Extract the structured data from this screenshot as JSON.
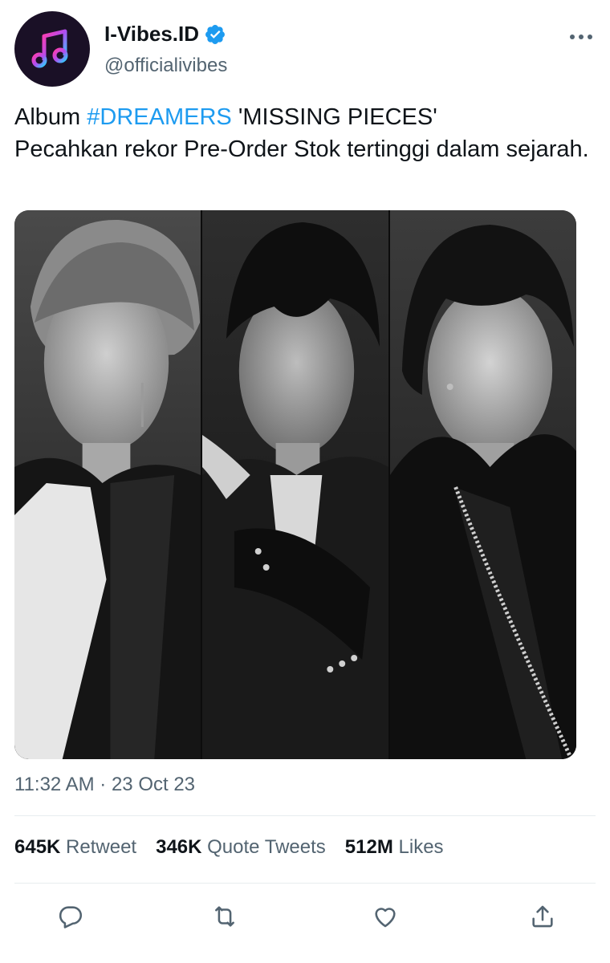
{
  "account": {
    "display_name": "I-Vibes.ID",
    "handle": "@officialivibes",
    "avatar_icon": "music-note-icon",
    "verified_icon": "verified-badge-icon",
    "brand_colors": {
      "pink": "#ff3cac",
      "purple": "#7b2ff7",
      "blue": "#2b86c5"
    }
  },
  "tweet": {
    "text_prefix": "Album ",
    "hashtag": "#DREAMERS",
    "text_after_hashtag": " 'MISSING PIECES'",
    "text_line2": "Pecahkan rekor Pre-Order Stok tertinggi dalam sejarah.",
    "image_alt": "Three black-and-white portraits of men in dark suits"
  },
  "meta": {
    "timestamp": "11:32 AM · 23 Oct 23"
  },
  "stats": [
    {
      "count": "645K",
      "label": "Retweet"
    },
    {
      "count": "346K",
      "label": "Quote Tweets"
    },
    {
      "count": "512M",
      "label": "Likes"
    }
  ],
  "actions": [
    "reply-icon",
    "retweet-icon",
    "like-icon",
    "share-icon"
  ],
  "colors": {
    "link": "#1d9bf0",
    "secondary_text": "#536471",
    "verified": "#1d9bf0"
  }
}
